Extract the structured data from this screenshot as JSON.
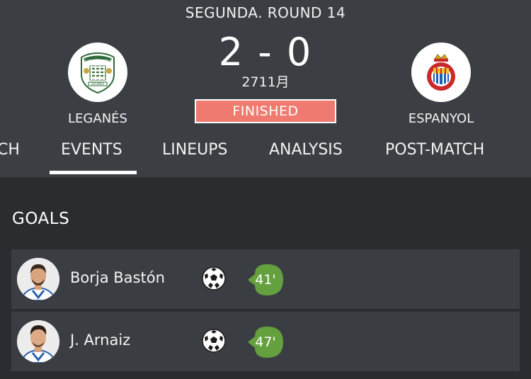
{
  "match": {
    "competition_round": "SEGUNDA. ROUND 14",
    "score": "2 - 0",
    "date": "2711月",
    "status": "FINISHED",
    "home_team": "LEGANÉS",
    "away_team": "ESPANYOL"
  },
  "tabs": [
    {
      "label": "CH"
    },
    {
      "label": "EVENTS",
      "active": true
    },
    {
      "label": "LINEUPS"
    },
    {
      "label": "ANALYSIS"
    },
    {
      "label": "POST-MATCH"
    }
  ],
  "events": {
    "section_title": "GOALS",
    "goals": [
      {
        "player": "Borja Bastón",
        "minute": "41'",
        "icon": "soccer-ball-icon"
      },
      {
        "player": "J. Arnaiz",
        "minute": "47'",
        "icon": "soccer-ball-icon"
      }
    ]
  },
  "colors": {
    "status_badge": "#ef7a6f",
    "minute_badge": "#64a03e",
    "header_bg": "#3b3f43",
    "body_bg": "#2a2d30",
    "row_bg": "#3a3e42"
  }
}
